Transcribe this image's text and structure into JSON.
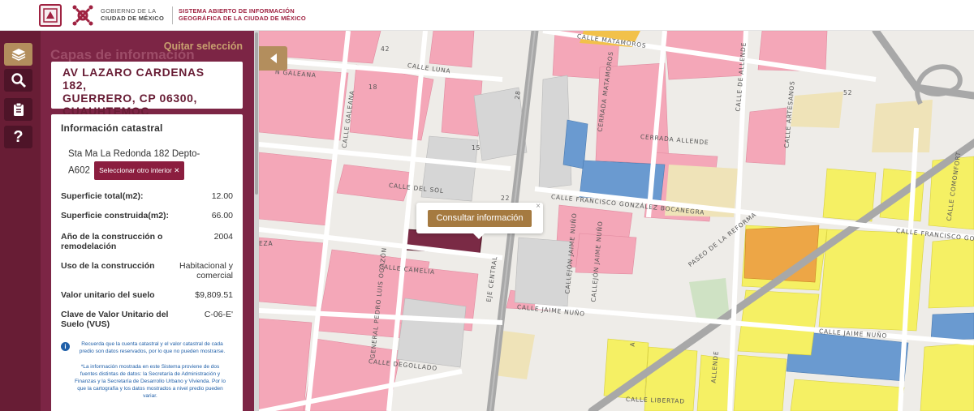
{
  "header": {
    "gov_line1": "GOBIERNO DE LA",
    "gov_line2": "CIUDAD DE MÉXICO",
    "sys_line1": "SISTEMA ABIERTO DE INFORMACIÓN",
    "sys_line2": "GEOGRÁFICA DE LA CIUDAD DE MÉXICO"
  },
  "rail": {
    "icons": [
      "layers-icon",
      "search-icon",
      "clipboard-icon",
      "help-icon"
    ],
    "help_label": "?"
  },
  "panel": {
    "quitar_label": "Quitar selección",
    "ghost_title": "Capas de información",
    "address_lines": [
      "AV LAZARO CARDENAS 182,",
      "GUERRERO, CP 06300,",
      "CUAUHTEMOC"
    ],
    "info_title": "Información catastral",
    "interior_text_1": "Sta Ma La Redonda 182 Depto-",
    "interior_text_2": "A602",
    "select_interior_label": "Seleccionar otro interior ✕",
    "rows": [
      {
        "key": "Superficie total(m2):",
        "value": "12.00"
      },
      {
        "key": "Superficie construida(m2):",
        "value": "66.00"
      },
      {
        "key": "Año de la construcción o remodelación",
        "value": "2004"
      },
      {
        "key": "Uso de la construcción",
        "value": "Habitacional y comercial"
      },
      {
        "key": "Valor unitario del suelo",
        "value": "$9,809.51"
      },
      {
        "key": "Clave de Valor Unitario del Suelo (VUS)",
        "value": "C-06-E'"
      }
    ],
    "note_1": "Recuerda que la cuenta catastral y el valor catastral de cada predio son datos reservados, por lo que no pueden mostrarse.",
    "note_2": "*La información mostrada en este Sistema proviene de dos fuentes distintas de datos: la Secretaría de Administración y Finanzas y la Secretaría de Desarrollo Urbano y Vivienda. Por lo que la cartografía y los datos mostrados a nivel predio pueden variar."
  },
  "map": {
    "popup_button": "Consultar información",
    "popup_close": "×",
    "streets": {
      "matamoros": "CALLE MATAMOROS",
      "luna": "CALLE LUNA",
      "galeana_top": "N GALEANA",
      "galeana": "CALLE GALEANA",
      "cerrada_allende": "CERRADA ALLENDE",
      "cerrada_matamoros": "CERRADA MATAMOROS",
      "de_allende": "CALLE DE ALLENDE",
      "artesanos": "CALLE ARTESANOS",
      "del_sol": "CALLE DEL SOL",
      "bocanegra": "CALLE FRANCISCO GONZÁLEZ BOCANEGRA",
      "comonfort": "CALLE COMONFORT",
      "francisco_right": "CALLE FRANCISCO GON",
      "reforma": "PASEO DE LA REFORMA",
      "camelia": "CALLE CAMELIA",
      "eje_central": "EJE CENTRAL",
      "pedro_luis": "GENERAL PEDRO LUIS OGAZÓN",
      "callejon_nuno_1": "CALLEJÓN JAIME NUÑO",
      "callejon_nuno_2": "CALLEJÓN JAIME NUÑO",
      "jaime_nuno": "CALLE JAIME NUÑO",
      "jaime_nuno_right": "CALLE JAIME NUÑO",
      "degollado": "CALLE DEGOLLADO",
      "libertad": "CALLE LIBERTAD",
      "allende_bottom": "ALLENDE",
      "frag1": "A",
      "frag2": "EZA"
    },
    "numbers": [
      "42",
      "28",
      "52",
      "18",
      "22",
      "15"
    ]
  },
  "colors": {
    "rail": "#681d35",
    "panel": "#7c2545",
    "gold": "#b38e5d",
    "pink": "#f4a8b8",
    "yellow": "#f5f06a",
    "blue": "#5b8fc4",
    "orange": "#e8a040"
  }
}
